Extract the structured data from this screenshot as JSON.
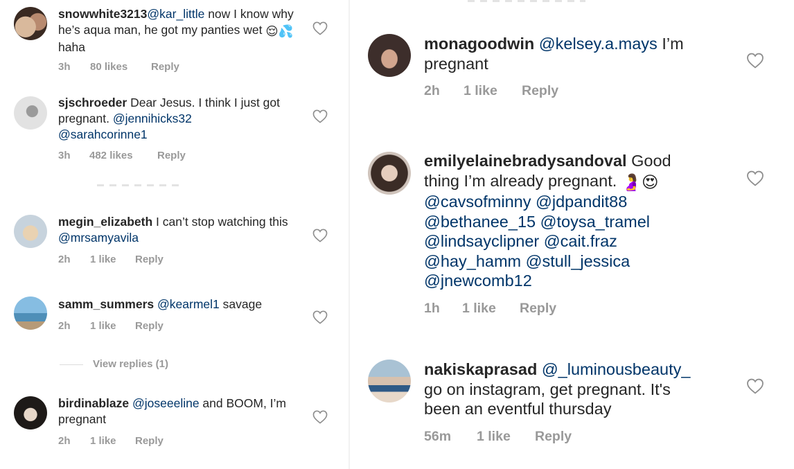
{
  "left": {
    "comments": [
      {
        "username": "snowwhite3213",
        "mention": "@kar_little",
        "text_before": " now I know why he’s aqua man, he got my panties wet ",
        "emoji": "😌💦",
        "text_after": " haha",
        "time": "3h",
        "likes": "80 likes",
        "reply": "Reply",
        "avatar_colors": [
          "#c9a58a",
          "#3a2a22"
        ]
      },
      {
        "username": "sjschroeder",
        "text": " Dear Jesus. I think I just got pregnant. ",
        "mention1": "@jennihicks32",
        "mention2": "@sarahcorinne1",
        "time": "3h",
        "likes": "482 likes",
        "reply": "Reply",
        "avatar_colors": [
          "#d7d7d7",
          "#7c7c7c"
        ]
      },
      {
        "username": "megin_elizabeth",
        "text": " I can’t stop watching this ",
        "mention": "@mrsamyavila",
        "time": "2h",
        "likes": "1 like",
        "reply": "Reply",
        "avatar_colors": [
          "#c6d2dc",
          "#e8d3b0"
        ]
      },
      {
        "username": "samm_summers",
        "mention": "@kearmel1",
        "text": " savage",
        "time": "2h",
        "likes": "1 like",
        "reply": "Reply",
        "avatar_colors": [
          "#7fb3d9",
          "#3e3a2e"
        ]
      },
      {
        "username": "birdinablaze",
        "mention": "@joseeeline",
        "text": " and BOOM, I’m pregnant",
        "time": "2h",
        "likes": "1 like",
        "reply": "Reply",
        "avatar_colors": [
          "#ddd7cf",
          "#1e1a18"
        ]
      }
    ],
    "view_replies": "View replies (1)"
  },
  "right": {
    "comments": [
      {
        "username": "monagoodwin",
        "mention": "@kelsey.a.mays",
        "text": " I’m pregnant",
        "time": "2h",
        "likes": "1 like",
        "reply": "Reply",
        "avatar_colors": [
          "#4a3a36",
          "#c9a08a"
        ]
      },
      {
        "username": "emilyelainebradysandoval",
        "text": " Good thing I’m already pregnant. ",
        "emoji": "🤰😍",
        "mentions": [
          "@cavsofminny",
          "@jdpandit88",
          "@bethanee_15",
          "@toysa_tramel",
          "@lindsayclipner",
          "@cait.fraz",
          "@hay_hamm",
          "@stull_jessica",
          "@jnewcomb12"
        ],
        "time": "1h",
        "likes": "1 like",
        "reply": "Reply",
        "avatar_colors": [
          "#cfc3bb",
          "#3b2c26"
        ]
      },
      {
        "username": "nakiskaprasad",
        "mention": "@_luminousbeauty_",
        "text": " go on instagram, get pregnant. It's been an eventful thursday",
        "time": "56m",
        "likes": "1 like",
        "reply": "Reply",
        "avatar_colors": [
          "#9fb5c5",
          "#d86b7a"
        ]
      }
    ]
  },
  "icons": {
    "like": "heart-outline-icon"
  },
  "colors": {
    "mention": "#003569",
    "meta": "#999999",
    "text": "#262626"
  }
}
